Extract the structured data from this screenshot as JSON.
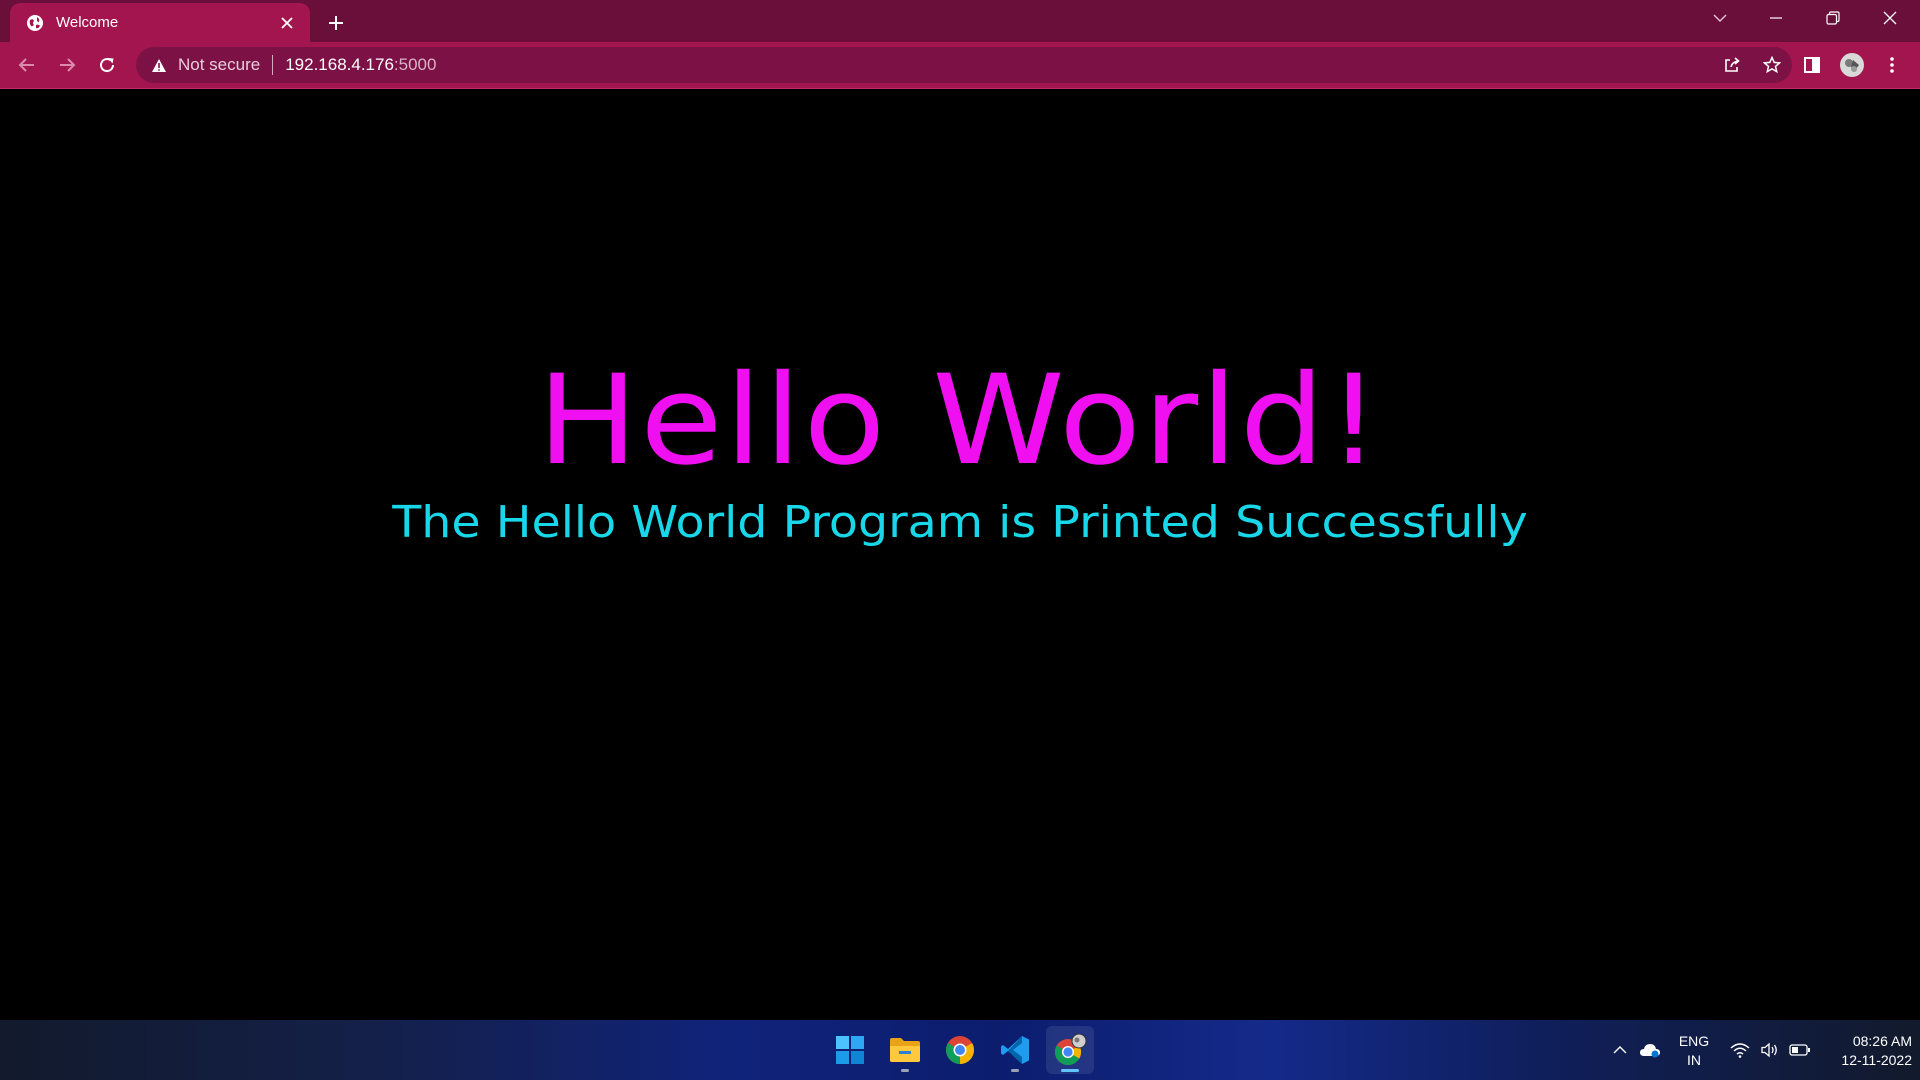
{
  "browser": {
    "tab": {
      "title": "Welcome"
    },
    "address_bar": {
      "security_label": "Not secure",
      "url_host": "192.168.4.176",
      "url_port": ":5000"
    },
    "icons": {
      "favicon": "globe-icon",
      "tab_close": "close-icon",
      "new_tab": "plus-icon",
      "tab_search": "chevron-down-icon",
      "back": "back-arrow-icon",
      "forward": "forward-arrow-icon",
      "reload": "reload-icon",
      "security": "warning-icon",
      "share": "share-icon",
      "bookmark": "star-icon",
      "side_panel": "side-panel-icon",
      "profile": "avatar-icon",
      "menu": "kebab-menu-icon"
    },
    "colors": {
      "frame": "#6a0e3a",
      "toolbar": "#a3154f",
      "omnibox": "#7c1146"
    }
  },
  "page": {
    "heading": "Hello World!",
    "subheading": "The Hello World Program is Printed Successfully",
    "colors": {
      "background": "#000000",
      "heading": "#f00ff0",
      "subheading": "#17d7e8"
    }
  },
  "taskbar": {
    "apps": [
      "start-icon",
      "file-explorer-icon",
      "chrome-icon",
      "vscode-icon",
      "chrome-profile-icon"
    ],
    "tray": {
      "language_line1": "ENG",
      "language_line2": "IN",
      "time": "08:26 AM",
      "date": "12-11-2022"
    }
  }
}
